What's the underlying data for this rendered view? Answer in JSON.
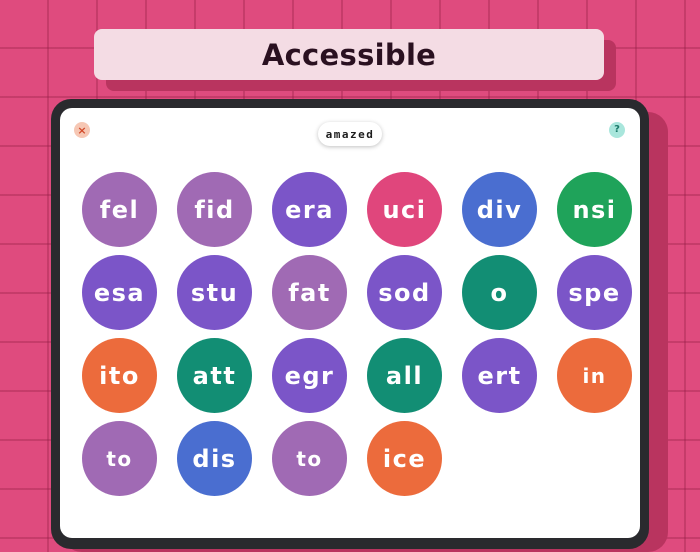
{
  "banner": {
    "title": "Accessible"
  },
  "header": {
    "close_icon": "×",
    "help_icon": "?",
    "target_word": "amazed"
  },
  "colors": {
    "purple_light": "#a06ab4",
    "purple": "#7b55c8",
    "pink": "#e0467c",
    "blue": "#4a6ed0",
    "green": "#1fa35a",
    "teal": "#128e74",
    "orange": "#ec6b3c"
  },
  "bubbles": [
    {
      "label": "fel",
      "color": "#a06ab4"
    },
    {
      "label": "fid",
      "color": "#a06ab4"
    },
    {
      "label": "era",
      "color": "#7b55c8"
    },
    {
      "label": "uci",
      "color": "#e0467c"
    },
    {
      "label": "div",
      "color": "#4a6ed0"
    },
    {
      "label": "nsi",
      "color": "#1fa35a"
    },
    {
      "label": "esa",
      "color": "#7b55c8"
    },
    {
      "label": "stu",
      "color": "#7b55c8"
    },
    {
      "label": "fat",
      "color": "#a06ab4"
    },
    {
      "label": "sod",
      "color": "#7b55c8"
    },
    {
      "label": "o",
      "color": "#128e74"
    },
    {
      "label": "spe",
      "color": "#7b55c8"
    },
    {
      "label": "ito",
      "color": "#ec6b3c"
    },
    {
      "label": "att",
      "color": "#128e74"
    },
    {
      "label": "egr",
      "color": "#7b55c8"
    },
    {
      "label": "all",
      "color": "#128e74"
    },
    {
      "label": "ert",
      "color": "#7b55c8"
    },
    {
      "label": "in",
      "color": "#ec6b3c"
    },
    {
      "label": "to",
      "color": "#a06ab4"
    },
    {
      "label": "dis",
      "color": "#4a6ed0"
    },
    {
      "label": "to",
      "color": "#a06ab4"
    },
    {
      "label": "ice",
      "color": "#ec6b3c"
    }
  ]
}
